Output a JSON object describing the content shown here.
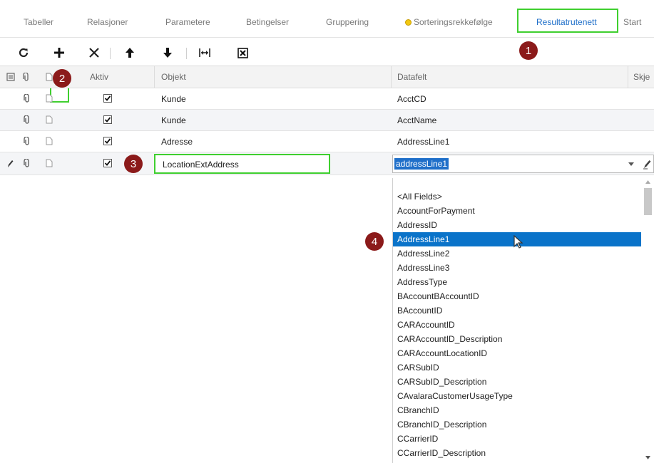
{
  "tabs": [
    {
      "label": "Tabeller"
    },
    {
      "label": "Relasjoner"
    },
    {
      "label": "Parametere"
    },
    {
      "label": "Betingelser"
    },
    {
      "label": "Gruppering"
    },
    {
      "label": "Sorteringsrekkefølge"
    },
    {
      "label": "Resultatrutenett"
    },
    {
      "label": "Start"
    }
  ],
  "active_tab": "Resultatrutenett",
  "toolbar": {
    "buttons": [
      "refresh-icon",
      "add-icon",
      "delete-icon",
      "move-up-icon",
      "move-down-icon",
      "fit-width-icon",
      "export-excel-icon"
    ]
  },
  "grid": {
    "headers": {
      "aktiv": "Aktiv",
      "objekt": "Objekt",
      "datafelt": "Datafelt",
      "skjema": "Skje"
    },
    "rows": [
      {
        "aktiv": true,
        "objekt": "Kunde",
        "datafelt": "AcctCD"
      },
      {
        "aktiv": true,
        "objekt": "Kunde",
        "datafelt": "AcctName"
      },
      {
        "aktiv": true,
        "objekt": "Adresse",
        "datafelt": "AddressLine1"
      }
    ],
    "edit_row": {
      "aktiv": true,
      "objekt": "LocationExtAddress",
      "datafelt": "addressLine1"
    }
  },
  "dropdown": {
    "selected": "AddressLine1",
    "options": [
      "<All Fields>",
      "AccountForPayment",
      "AddressID",
      "AddressLine1",
      "AddressLine2",
      "AddressLine3",
      "AddressType",
      "BAccountBAccountID",
      "BAccountID",
      "CARAccountID",
      "CARAccountID_Description",
      "CARAccountLocationID",
      "CARSubID",
      "CARSubID_Description",
      "CAvalaraCustomerUsageType",
      "CBranchID",
      "CBranchID_Description",
      "CCarrierID",
      "CCarrierID_Description"
    ]
  },
  "badges": [
    "1",
    "2",
    "3",
    "4"
  ],
  "colors": {
    "highlight": "#3fcf2f",
    "badge": "#8b1a1a",
    "accent": "#1f6fc9",
    "selection": "#0a73c9"
  }
}
